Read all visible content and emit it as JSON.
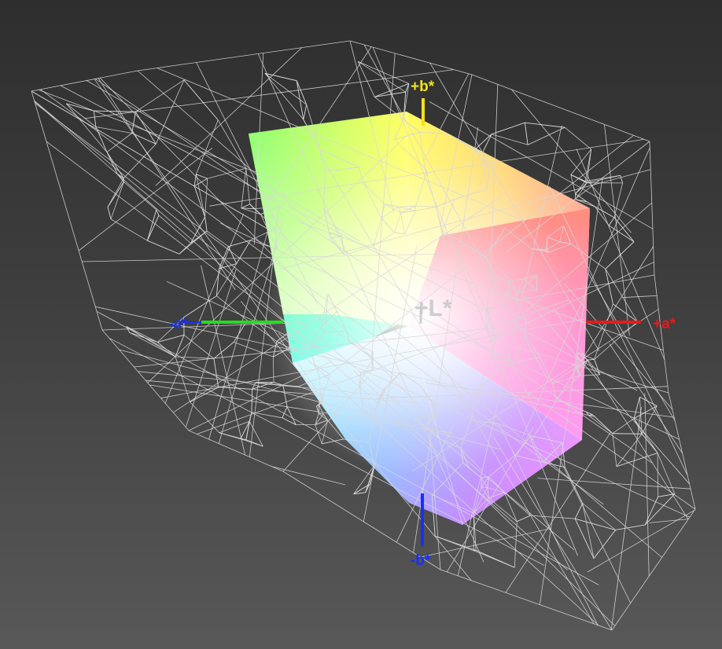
{
  "diagram": {
    "type": "3d color gamut comparison (CIE L*a*b*)",
    "solid_volume": "display gamut (colored solid)",
    "wireframe_volume": "reference gamut (gray wireframe)"
  },
  "axes": {
    "b_plus": {
      "label": "+b*",
      "color": "#f2e21a"
    },
    "b_minus": {
      "label": "-b*",
      "color": "#1530ff"
    },
    "a_plus": {
      "label": "+a*",
      "color": "#e81a1a"
    },
    "a_minus": {
      "label": "-a*",
      "color": "#1a30e0",
      "line_color": "#22dd22"
    },
    "l_plus": {
      "label": "+L*",
      "color": "#c6c6c6"
    }
  },
  "colors": {
    "background_top": "#2e2e2e",
    "background_bottom": "#585858",
    "wireframe": "#d8d8d8"
  }
}
